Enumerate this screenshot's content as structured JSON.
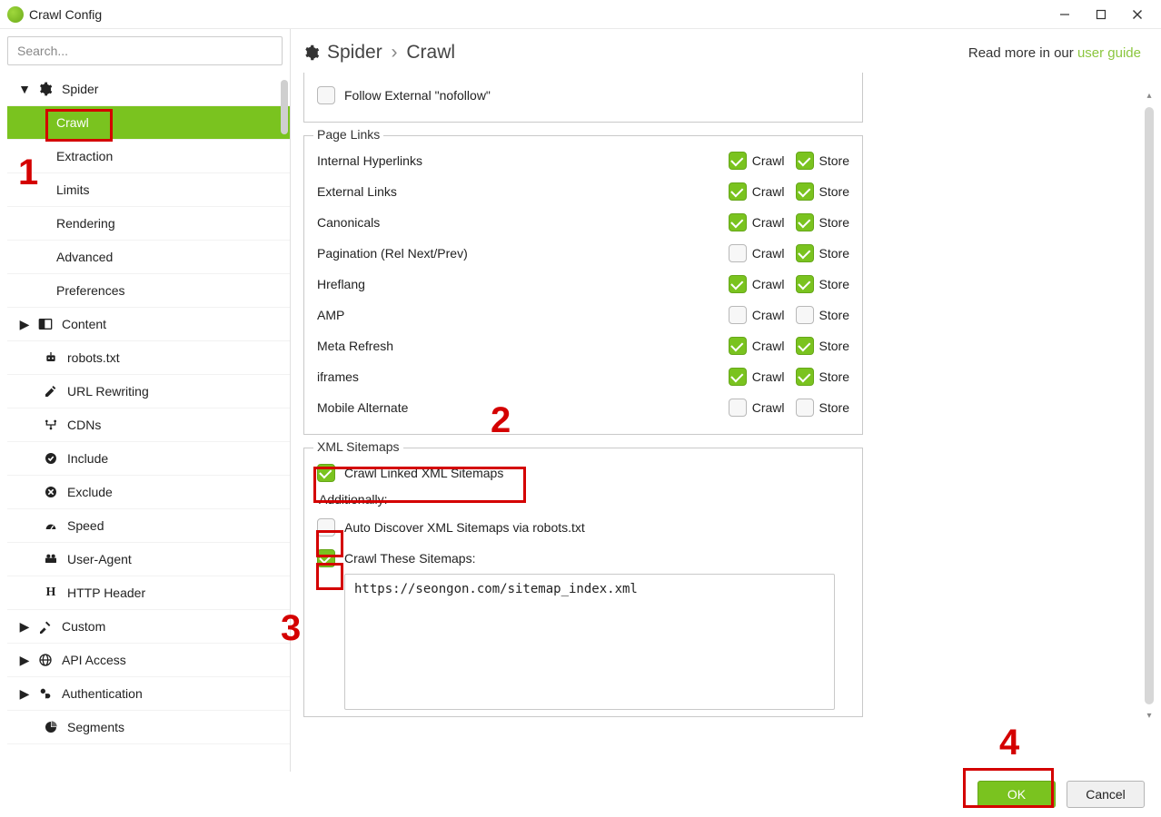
{
  "window": {
    "title": "Crawl Config"
  },
  "search": {
    "placeholder": "Search..."
  },
  "sidebar": {
    "spider": {
      "label": "Spider",
      "children": {
        "crawl": "Crawl",
        "extraction": "Extraction",
        "limits": "Limits",
        "rendering": "Rendering",
        "advanced": "Advanced",
        "preferences": "Preferences"
      }
    },
    "content": "Content",
    "robots": "robots.txt",
    "url_rewriting": "URL Rewriting",
    "cdns": "CDNs",
    "include": "Include",
    "exclude": "Exclude",
    "speed": "Speed",
    "user_agent": "User-Agent",
    "http_header": "HTTP Header",
    "custom": "Custom",
    "api_access": "API Access",
    "authentication": "Authentication",
    "segments": "Segments"
  },
  "breadcrumb": {
    "a": "Spider",
    "b": "Crawl"
  },
  "readmore": {
    "prefix": "Read more in our ",
    "link": "user guide"
  },
  "top_section": {
    "follow_external_nofollow": {
      "label": "Follow External \"nofollow\"",
      "checked": false
    }
  },
  "page_links": {
    "title": "Page Links",
    "crawl_label": "Crawl",
    "store_label": "Store",
    "rows": [
      {
        "name": "Internal Hyperlinks",
        "crawl": true,
        "store": true
      },
      {
        "name": "External Links",
        "crawl": true,
        "store": true
      },
      {
        "name": "Canonicals",
        "crawl": true,
        "store": true
      },
      {
        "name": "Pagination (Rel Next/Prev)",
        "crawl": false,
        "store": true
      },
      {
        "name": "Hreflang",
        "crawl": true,
        "store": true
      },
      {
        "name": "AMP",
        "crawl": false,
        "store": false
      },
      {
        "name": "Meta Refresh",
        "crawl": true,
        "store": true
      },
      {
        "name": "iframes",
        "crawl": true,
        "store": true
      },
      {
        "name": "Mobile Alternate",
        "crawl": false,
        "store": false
      }
    ]
  },
  "xml_sitemaps": {
    "title": "XML Sitemaps",
    "crawl_linked": {
      "label": "Crawl Linked XML Sitemaps",
      "checked": true
    },
    "additionally": "Additionally:",
    "auto_discover": {
      "label": "Auto Discover XML Sitemaps via robots.txt",
      "checked": false
    },
    "crawl_these": {
      "label": "Crawl These Sitemaps:",
      "checked": true
    },
    "textarea_value": "https://seongon.com/sitemap_index.xml"
  },
  "buttons": {
    "ok": "OK",
    "cancel": "Cancel"
  },
  "annotations": {
    "n1": "1",
    "n2": "2",
    "n3": "3",
    "n4": "4"
  }
}
